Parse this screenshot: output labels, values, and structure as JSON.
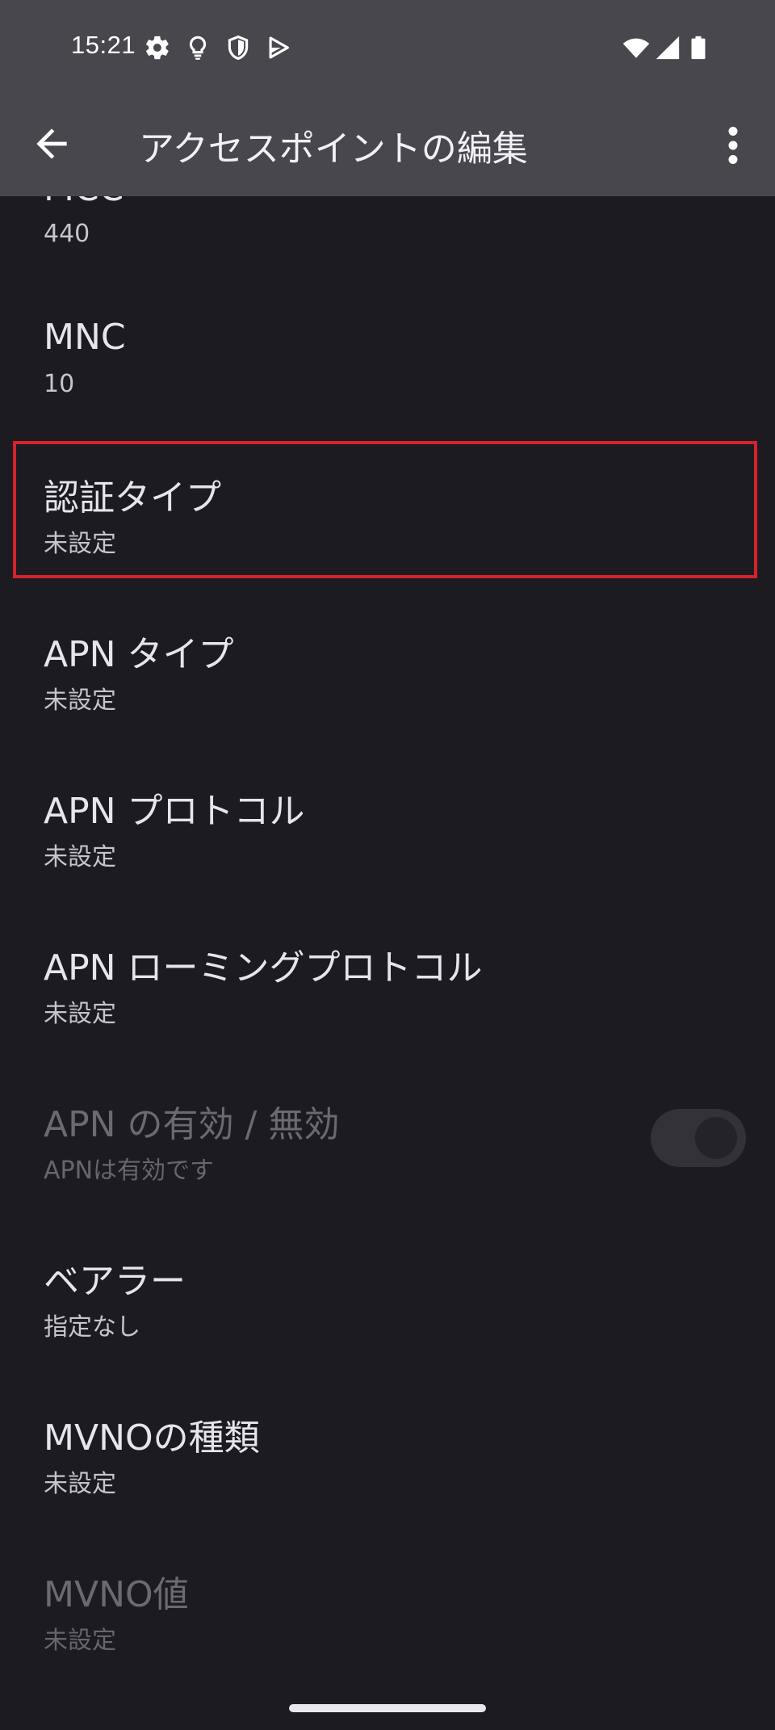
{
  "status": {
    "time": "15:21",
    "icons_left": [
      "gear-icon",
      "bulb-icon",
      "shield-icon",
      "play-store-icon"
    ],
    "icons_right": [
      "wifi-icon",
      "signal-icon",
      "battery-icon"
    ]
  },
  "appbar": {
    "title": "アクセスポイントの編集",
    "back_icon": "arrow-back-icon",
    "menu_icon": "more-vert-icon"
  },
  "items": [
    {
      "key": "mcc",
      "title": "MCC",
      "summary": "440"
    },
    {
      "key": "mnc",
      "title": "MNC",
      "summary": "10"
    },
    {
      "key": "auth-type",
      "title": "認証タイプ",
      "summary": "未設定"
    },
    {
      "key": "apn-type",
      "title": "APN タイプ",
      "summary": "未設定"
    },
    {
      "key": "apn-protocol",
      "title": "APN プロトコル",
      "summary": "未設定"
    },
    {
      "key": "apn-roaming-protocol",
      "title": "APN ローミングプロトコル",
      "summary": "未設定"
    },
    {
      "key": "apn-enable",
      "title": "APN の有効 / 無効",
      "summary": "APNは有効です"
    },
    {
      "key": "bearer",
      "title": "ベアラー",
      "summary": "指定なし"
    },
    {
      "key": "mvno-type",
      "title": "MVNOの種類",
      "summary": "未設定"
    },
    {
      "key": "mvno-value",
      "title": "MVNO値",
      "summary": "未設定"
    }
  ],
  "colors": {
    "background": "#1c1b21",
    "topbar": "#48474d",
    "highlight": "#d4232a"
  }
}
